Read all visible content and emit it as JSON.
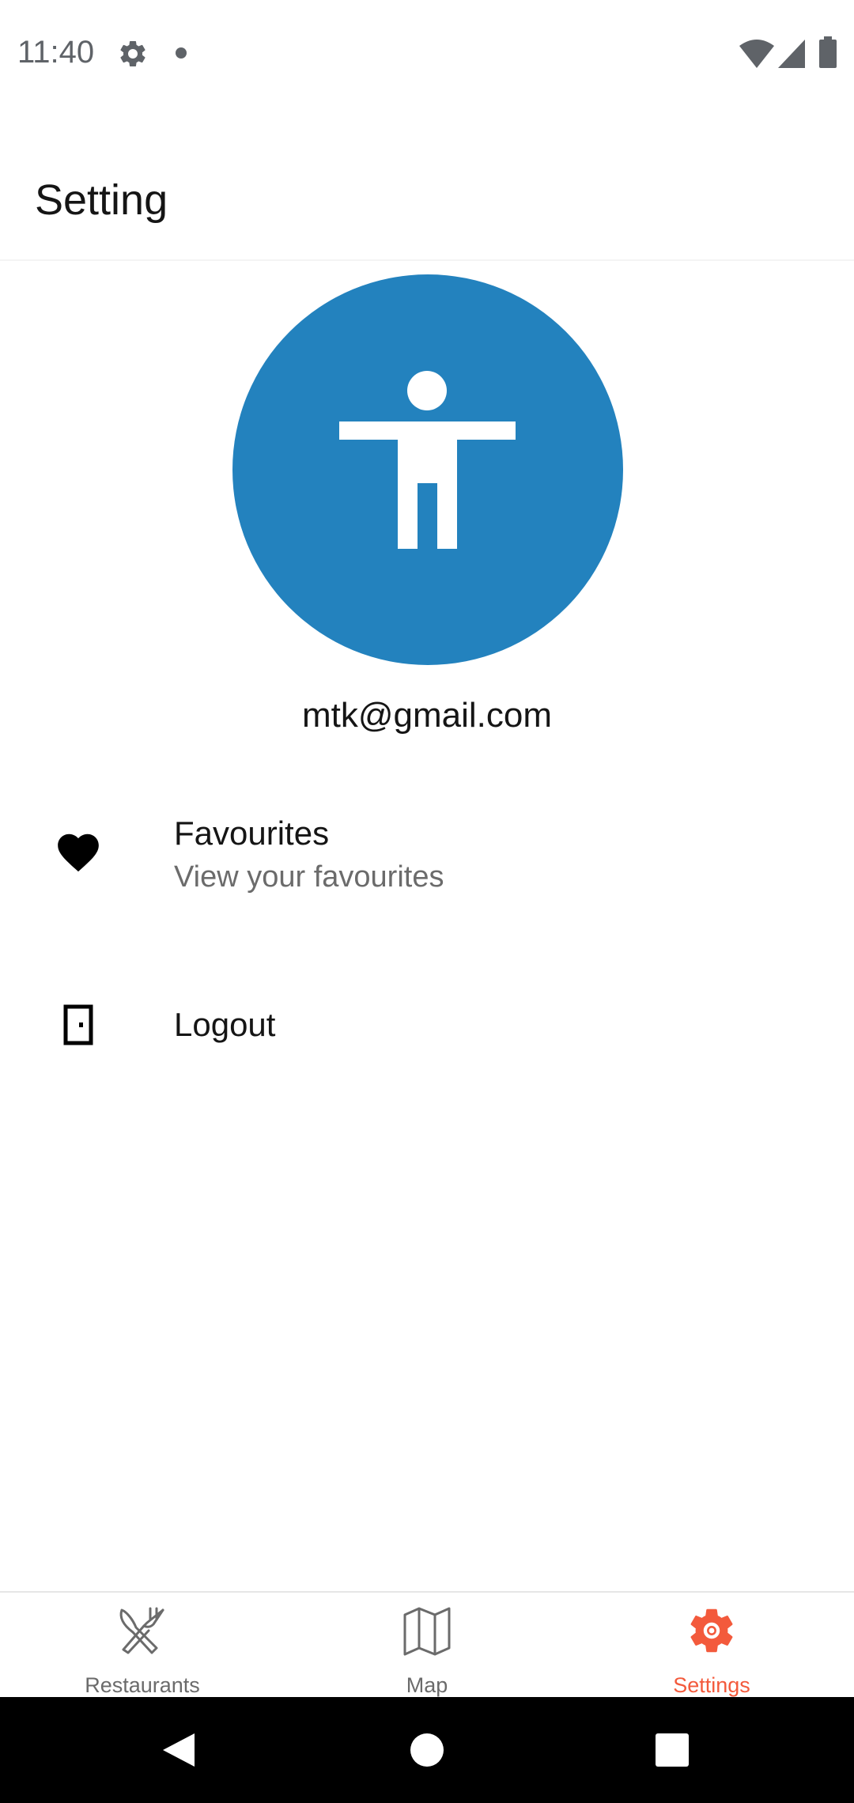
{
  "status_bar": {
    "time": "11:40",
    "icons": [
      "gear-icon",
      "notification-dot-icon",
      "wifi-icon",
      "signal-icon",
      "battery-icon"
    ]
  },
  "header": {
    "title": "Setting"
  },
  "profile": {
    "avatar_icon": "accessibility-person-icon",
    "avatar_color": "#2382be",
    "email": "mtk@gmail.com"
  },
  "menu": {
    "favourites": {
      "icon": "heart-icon",
      "title": "Favourites",
      "subtitle": "View your favourites"
    },
    "logout": {
      "icon": "door-icon",
      "title": "Logout"
    }
  },
  "bottom_nav": {
    "active_color": "#f35a3c",
    "inactive_color": "#6b6b6b",
    "items": [
      {
        "label": "Restaurants",
        "icon": "fork-knife-icon",
        "active": false
      },
      {
        "label": "Map",
        "icon": "map-icon",
        "active": false
      },
      {
        "label": "Settings",
        "icon": "settings-gear-icon",
        "active": true
      }
    ]
  },
  "system_nav": {
    "icons": [
      "back-icon",
      "home-icon",
      "recents-icon"
    ]
  }
}
